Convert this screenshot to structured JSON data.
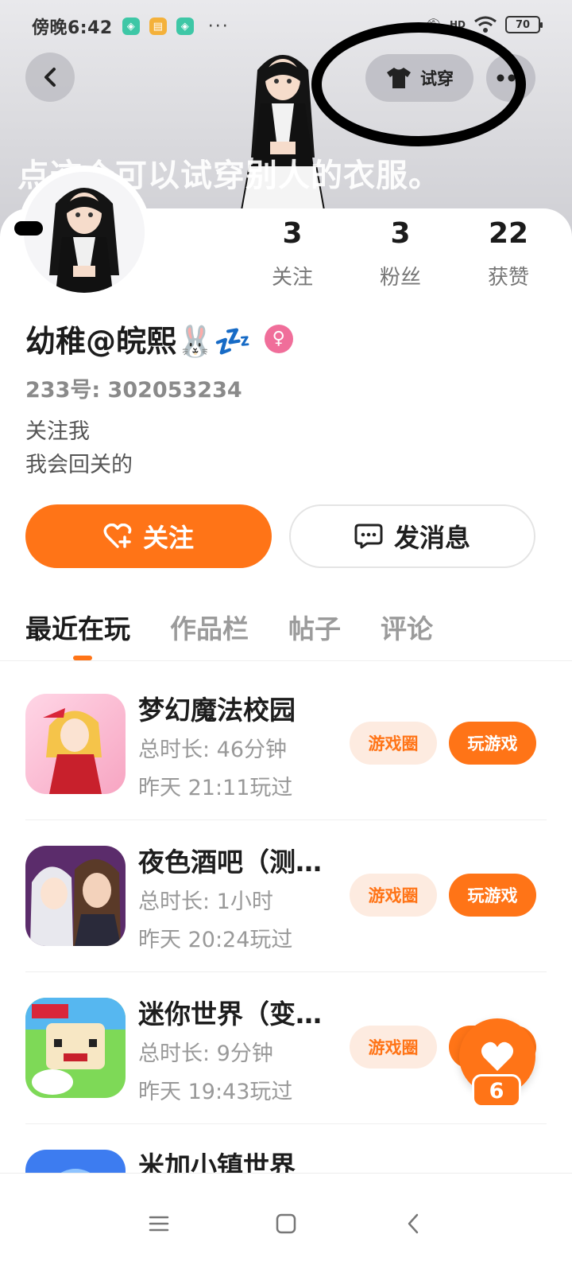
{
  "status_bar": {
    "time": "傍晚6:42",
    "more": "···",
    "network": "HD",
    "battery": "70"
  },
  "header": {
    "tryon_label": "试穿",
    "overlay_note": "点这个可以试穿别人的衣服。"
  },
  "profile": {
    "stats": [
      {
        "value": "3",
        "label": "关注"
      },
      {
        "value": "3",
        "label": "粉丝"
      },
      {
        "value": "22",
        "label": "获赞"
      }
    ],
    "name": "幼稚@皖熙🐰💤",
    "gender_symbol": "♀",
    "uid": "233号: 302053234",
    "bio_line1": "关注我",
    "bio_line2": "我会回关的"
  },
  "actions": {
    "follow_label": "关注",
    "message_label": "发消息"
  },
  "tabs": [
    "最近在玩",
    "作品栏",
    "帖子",
    "评论"
  ],
  "games": [
    {
      "title": "梦幻魔法校园",
      "duration": "总时长: 46分钟",
      "last_played": "昨天 21:11玩过"
    },
    {
      "title": "夜色酒吧（测试版）",
      "duration": "总时长: 1小时",
      "last_played": "昨天 20:24玩过"
    },
    {
      "title": "迷你世界（变态版）",
      "duration": "总时长: 9分钟",
      "last_played": "昨天 19:43玩过"
    },
    {
      "title": "米加小镇世界",
      "duration": "",
      "last_played": ""
    }
  ],
  "game_buttons": {
    "circle_label": "游戏圈",
    "play_label": "玩游戏"
  },
  "like_fab": {
    "count": "6"
  },
  "colors": {
    "accent": "#ff7417",
    "accent_light": "#fdebe0",
    "female": "#f06e9a"
  },
  "icons": [
    "back-arrow-icon",
    "tshirt-icon",
    "more-dots-icon",
    "heart-plus-icon",
    "chat-bubble-icon",
    "heart-icon",
    "menu-icon",
    "home-square-icon",
    "nav-back-icon"
  ]
}
